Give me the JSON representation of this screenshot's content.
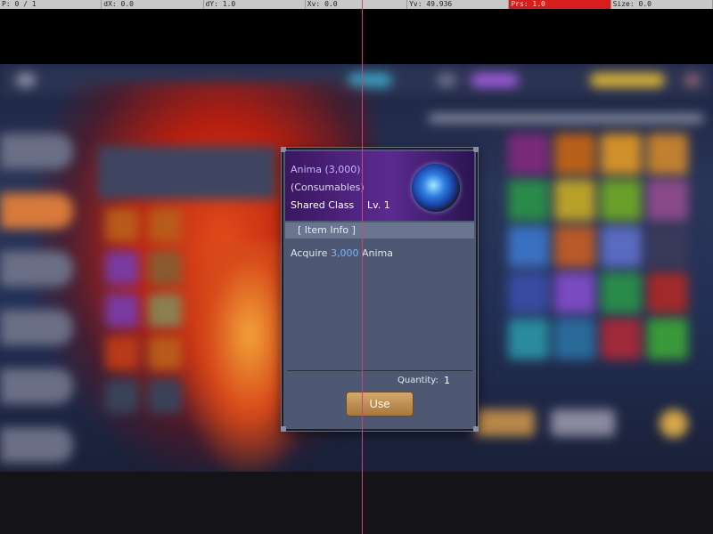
{
  "debug": {
    "pointer": "P: 0 / 1",
    "dx": "dX: 0.0",
    "dy": "dY: 1.0",
    "xv": "Xv: 0.0",
    "yv": "Yv: 49.936",
    "prs": "Prs: 1.0",
    "size": "Size: 0.0"
  },
  "dialog": {
    "item_name": "Anima (3,000)",
    "item_type": "(Consumables)",
    "item_class": "Shared Class",
    "item_level": "Lv. 1",
    "icon": "anima-orb-icon",
    "info_tab": "[ Item Info ]",
    "desc_prefix": "Acquire",
    "desc_amount": "3,000",
    "desc_suffix": "Anima",
    "quantity_label": "Quantity:",
    "quantity_value": "1",
    "use_label": "Use"
  },
  "colors": {
    "accent_text": "#c8b4ff",
    "highlight": "#79b6ff",
    "button": "#c0904f"
  }
}
